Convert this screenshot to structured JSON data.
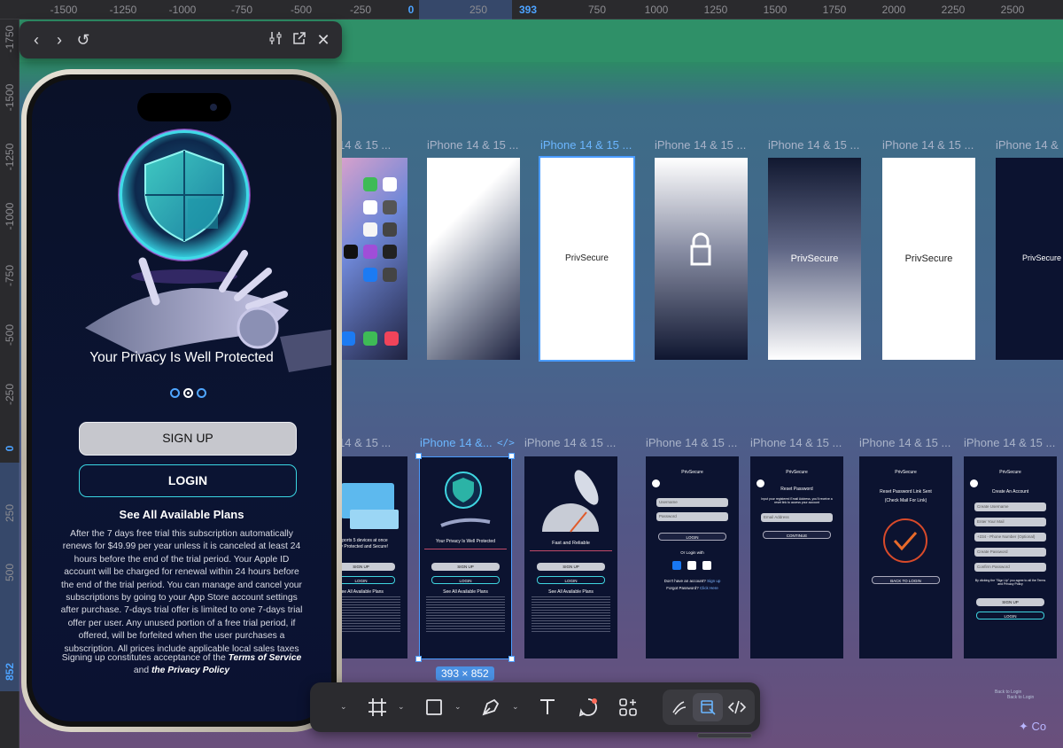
{
  "rulers": {
    "top": [
      "-1500",
      "-1250",
      "-1000",
      "-750",
      "-500",
      "-250",
      "0",
      "250",
      "393",
      "750",
      "1000",
      "1250",
      "1500",
      "1750",
      "2000",
      "2250",
      "2500"
    ],
    "left": [
      "-1750",
      "-1500",
      "-1250",
      "-1000",
      "-750",
      "-500",
      "-250",
      "0",
      "250",
      "500",
      "852"
    ]
  },
  "frames": {
    "row1_labels": [
      "14 & 15 ...",
      "iPhone 14 & 15 ...",
      "iPhone 14 & 15 ...",
      "iPhone 14 & 15 ...",
      "iPhone 14 & 15 ...",
      "iPhone 14 & 15 ...",
      "iPhone 14 &"
    ],
    "row2_labels": [
      "14 & 15 ...",
      "iPhone 14 &...",
      "iPhone 14 & 15 ...",
      "iPhone 14 & 15 ...",
      "iPhone 14 & 15 ...",
      "iPhone 14 & 15 ...",
      "iPhone 14 & 15 ..."
    ],
    "brand": "PrivSecure",
    "dimensions": "393 × 852"
  },
  "minis": {
    "s1_line1": "Supports 5 devices at once",
    "s1_line2": "Stay Protected and Secure!",
    "s2_title": "Your Privacy Is Well Protected",
    "s3_title": "Fast and Reliable",
    "signup": "SIGN UP",
    "login": "LOGIN",
    "plans": "See All Available Plans",
    "username": "Username",
    "password": "Password",
    "or_login": "Or Login with",
    "no_account": "Don't have an account?",
    "signup_link": "Sign up",
    "forgot": "Forgot Password?",
    "click_here": "Click Here",
    "reset_title": "Reset Password",
    "reset_desc": "Input your registered Email Address, you'll receive a reset link to access your account",
    "email": "Email Address",
    "continue": "CONTINUE",
    "sent_title": "Reset Password Link Sent",
    "sent_sub": "(Check Mail For Link)",
    "back_login": "BACK TO LOGIN",
    "create_title": "Create An Account",
    "create_fields": [
      "Create Username",
      "Enter Your Mail",
      "+234 - Phone Number (Optional)",
      "Create Password",
      "Confirm Password"
    ],
    "terms_mini": "By clicking the \"Sign Up\" you agree to all the Terms and Privacy Policy",
    "back_note1": "Back to Login",
    "back_note2": "Back to Login"
  },
  "preview": {
    "headline": "Your Privacy Is Well Protected",
    "signup_label": "SIGN UP",
    "login_label": "LOGIN",
    "plans_label": "See All Available Plans",
    "legal": "After the 7 days free trial this subscription automatically renews for $49.99 per year unless it is canceled at least 24 hours before the end of the trial period. Your Apple ID account will be charged for renewal within 24 hours before the end of the trial period. You can manage and cancel your subscriptions by going to your App Store account settings after purchase. 7-days trial offer is limited to one 7-days trial offer per user. Any unused portion of a free trial period, if offered, will be forfeited when the user purchases a subscription. All prices include applicable local sales taxes",
    "terms_prefix": "Signing up constitutes acceptance of the",
    "terms_link": "Terms of Service",
    "terms_and": "and",
    "privacy_link": "the Privacy Policy"
  },
  "comments_label": "Co"
}
